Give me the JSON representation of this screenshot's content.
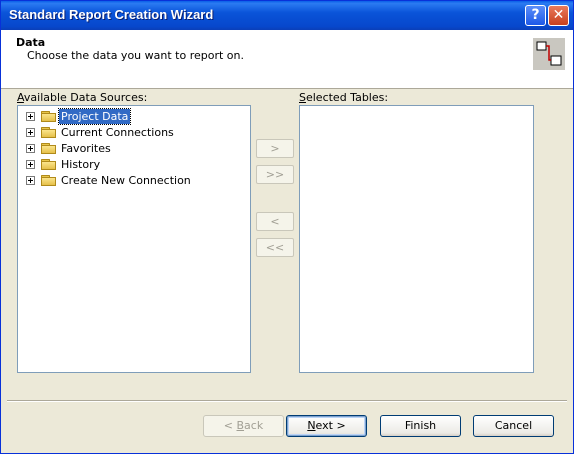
{
  "window": {
    "title": "Standard Report Creation Wizard",
    "help_glyph": "?",
    "close_glyph": "✕"
  },
  "header": {
    "title": "Data",
    "subtitle": "Choose the data you want to report on."
  },
  "available": {
    "label_accel": "A",
    "label_rest": "vailable Data Sources:",
    "items": [
      {
        "label": "Project Data",
        "selected": true,
        "expander": "collapsed",
        "icon": "folder-icon"
      },
      {
        "label": "Current Connections",
        "selected": false,
        "expander": "collapsed",
        "icon": "folder-icon"
      },
      {
        "label": "Favorites",
        "selected": false,
        "expander": "collapsed",
        "icon": "folder-icon"
      },
      {
        "label": "History",
        "selected": false,
        "expander": "collapsed",
        "icon": "folder-icon"
      },
      {
        "label": "Create New Connection",
        "selected": false,
        "expander": "collapsed",
        "icon": "folder-icon"
      }
    ]
  },
  "selected": {
    "label_accel": "S",
    "label_rest": "elected Tables:",
    "items": []
  },
  "transfer": {
    "add": ">",
    "add_all": ">>",
    "remove": "<",
    "remove_all": "<<"
  },
  "buttons": {
    "back_pre": "< ",
    "back_accel": "B",
    "back_rest": "ack",
    "next_accel": "N",
    "next_rest": "ext >",
    "finish": "Finish",
    "cancel": "Cancel"
  }
}
